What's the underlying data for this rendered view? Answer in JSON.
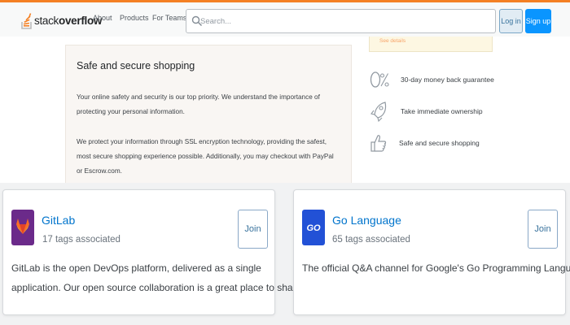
{
  "topbar": {
    "logo_text_light": "stack",
    "logo_text_bold": "overflow",
    "nav": [
      "About",
      "Products",
      "For Teams"
    ],
    "search_placeholder": "Search...",
    "login_label": "Log in",
    "signup_label": "Sign up",
    "accent_color": "#f48024"
  },
  "faded_card": {
    "label": "See details"
  },
  "shop": {
    "title": "Safe and secure shopping",
    "lines": [
      "Your online safety and security is our top priority. We understand the importance of",
      "protecting your personal information.",
      "We protect your information through SSL encryption technology, providing the safest,",
      "most secure shopping experience possible. Additionally, you may checkout with PayPal",
      "or Escrow.com."
    ]
  },
  "features": [
    {
      "label": "30-day money back guarantee",
      "icon": "zero-percent-icon"
    },
    {
      "label": "Take immediate ownership",
      "icon": "rocket-icon"
    },
    {
      "label": "Safe and secure shopping",
      "icon": "thumbs-up-icon"
    }
  ],
  "collectives": [
    {
      "name": "GitLab",
      "tags": "17 tags associated",
      "desc_lines": [
        "GitLab is the open DevOps platform, delivered as a single",
        "application. Our open source collaboration is a great place to sha…"
      ],
      "join_label": "Join",
      "logo_color": "#6b2a8a",
      "icon": "gitlab-logo-icon"
    },
    {
      "name": "Go Language",
      "tags": "65 tags associated",
      "desc_lines": [
        "The official Q&A channel for Google's Go Programming Language."
      ],
      "join_label": "Join",
      "logo_color": "#2251d6",
      "icon": "go-logo-icon"
    }
  ]
}
